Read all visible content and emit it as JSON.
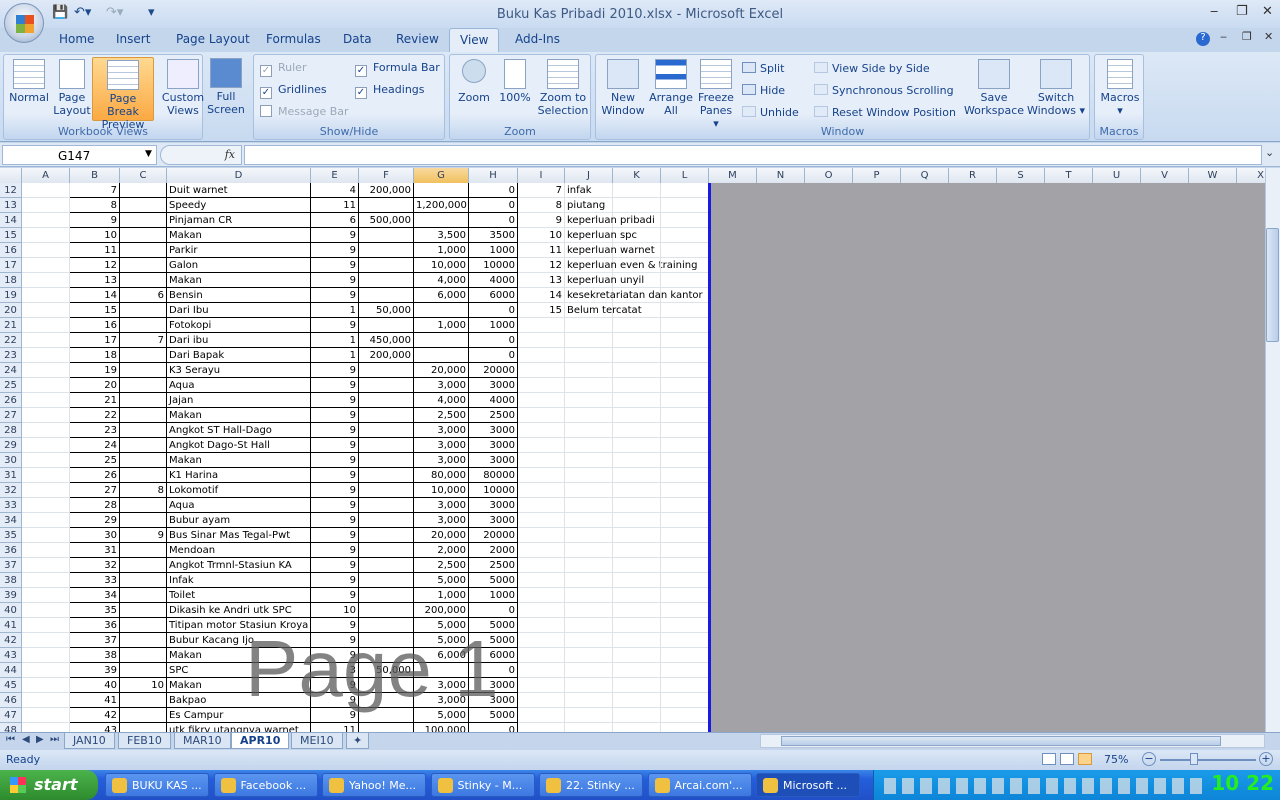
{
  "window": {
    "title": "Buku Kas Pribadi 2010.xlsx - Microsoft Excel",
    "minimize": "‒",
    "restore": "❐",
    "close": "✕"
  },
  "ribbon_tabs": [
    "Home",
    "Insert",
    "Page Layout",
    "Formulas",
    "Data",
    "Review",
    "View",
    "Add-Ins"
  ],
  "active_tab": "View",
  "groups": {
    "workbook_views": {
      "label": "Workbook Views",
      "normal": "Normal",
      "page_layout": [
        "Page",
        "Layout"
      ],
      "page_break": [
        "Page Break",
        "Preview"
      ],
      "custom": [
        "Custom",
        "Views"
      ],
      "full": [
        "Full",
        "Screen"
      ]
    },
    "show_hide": {
      "label": "Show/Hide",
      "ruler": "Ruler",
      "gridlines": "Gridlines",
      "message_bar": "Message Bar",
      "formula_bar": "Formula Bar",
      "headings": "Headings",
      "ruler_checked": true,
      "gridlines_checked": true,
      "message_bar_checked": false,
      "formula_bar_checked": true,
      "headings_checked": true
    },
    "zoom": {
      "label": "Zoom",
      "zoom": "Zoom",
      "hundred": "100%",
      "zoom_sel": [
        "Zoom to",
        "Selection"
      ]
    },
    "window": {
      "label": "Window",
      "new": [
        "New",
        "Window"
      ],
      "arrange": [
        "Arrange",
        "All"
      ],
      "freeze": [
        "Freeze",
        "Panes ▾"
      ],
      "split": "Split",
      "hide": "Hide",
      "unhide": "Unhide",
      "side": "View Side by Side",
      "sync": "Synchronous Scrolling",
      "reset": "Reset Window Position",
      "save": [
        "Save",
        "Workspace"
      ],
      "switch": [
        "Switch",
        "Windows ▾"
      ]
    },
    "macros": {
      "label": "Macros",
      "macros": "Macros"
    }
  },
  "formula_bar": {
    "name_box": "G147",
    "fx": "fx",
    "formula": ""
  },
  "columns": [
    "A",
    "B",
    "C",
    "D",
    "E",
    "F",
    "G",
    "H",
    "I",
    "J",
    "K",
    "L",
    "M",
    "N",
    "O",
    "P",
    "Q",
    "R",
    "S",
    "T",
    "U",
    "V",
    "W",
    "X"
  ],
  "selected_column": "G",
  "rows": [
    [
      "12",
      "7",
      "",
      "Duit warnet",
      "4",
      "200,000",
      "",
      "0",
      "7",
      "infak"
    ],
    [
      "13",
      "8",
      "",
      "Speedy",
      "11",
      "",
      "1,200,000",
      "0",
      "8",
      "piutang"
    ],
    [
      "14",
      "9",
      "",
      "Pinjaman CR",
      "6",
      "500,000",
      "",
      "0",
      "9",
      "keperluan pribadi"
    ],
    [
      "15",
      "10",
      "",
      "Makan",
      "9",
      "",
      "3,500",
      "3500",
      "10",
      "keperluan spc"
    ],
    [
      "16",
      "11",
      "",
      "Parkir",
      "9",
      "",
      "1,000",
      "1000",
      "11",
      "keperluan warnet"
    ],
    [
      "17",
      "12",
      "",
      "Galon",
      "9",
      "",
      "10,000",
      "10000",
      "12",
      "keperluan even & training"
    ],
    [
      "18",
      "13",
      "",
      "Makan",
      "9",
      "",
      "4,000",
      "4000",
      "13",
      "keperluan unyil"
    ],
    [
      "19",
      "14",
      "6",
      "Bensin",
      "9",
      "",
      "6,000",
      "6000",
      "14",
      "kesekretariatan dan kantor"
    ],
    [
      "20",
      "15",
      "",
      "Dari Ibu",
      "1",
      "50,000",
      "",
      "0",
      "15",
      "Belum tercatat"
    ],
    [
      "21",
      "16",
      "",
      "Fotokopi",
      "9",
      "",
      "1,000",
      "1000",
      "",
      ""
    ],
    [
      "22",
      "17",
      "7",
      "Dari ibu",
      "1",
      "450,000",
      "",
      "0",
      "",
      ""
    ],
    [
      "23",
      "18",
      "",
      "Dari Bapak",
      "1",
      "200,000",
      "",
      "0",
      "",
      ""
    ],
    [
      "24",
      "19",
      "",
      "K3 Serayu",
      "9",
      "",
      "20,000",
      "20000",
      "",
      ""
    ],
    [
      "25",
      "20",
      "",
      "Aqua",
      "9",
      "",
      "3,000",
      "3000",
      "",
      ""
    ],
    [
      "26",
      "21",
      "",
      "Jajan",
      "9",
      "",
      "4,000",
      "4000",
      "",
      ""
    ],
    [
      "27",
      "22",
      "",
      "Makan",
      "9",
      "",
      "2,500",
      "2500",
      "",
      ""
    ],
    [
      "28",
      "23",
      "",
      "Angkot ST Hall-Dago",
      "9",
      "",
      "3,000",
      "3000",
      "",
      ""
    ],
    [
      "29",
      "24",
      "",
      "Angkot Dago-St Hall",
      "9",
      "",
      "3,000",
      "3000",
      "",
      ""
    ],
    [
      "30",
      "25",
      "",
      "Makan",
      "9",
      "",
      "3,000",
      "3000",
      "",
      ""
    ],
    [
      "31",
      "26",
      "",
      "K1 Harina",
      "9",
      "",
      "80,000",
      "80000",
      "",
      ""
    ],
    [
      "32",
      "27",
      "8",
      "Lokomotif",
      "9",
      "",
      "10,000",
      "10000",
      "",
      ""
    ],
    [
      "33",
      "28",
      "",
      "Aqua",
      "9",
      "",
      "3,000",
      "3000",
      "",
      ""
    ],
    [
      "34",
      "29",
      "",
      "Bubur ayam",
      "9",
      "",
      "3,000",
      "3000",
      "",
      ""
    ],
    [
      "35",
      "30",
      "9",
      "Bus Sinar Mas Tegal-Pwt",
      "9",
      "",
      "20,000",
      "20000",
      "",
      ""
    ],
    [
      "36",
      "31",
      "",
      "Mendoan",
      "9",
      "",
      "2,000",
      "2000",
      "",
      ""
    ],
    [
      "37",
      "32",
      "",
      "Angkot Trmnl-Stasiun KA",
      "9",
      "",
      "2,500",
      "2500",
      "",
      ""
    ],
    [
      "38",
      "33",
      "",
      "Infak",
      "9",
      "",
      "5,000",
      "5000",
      "",
      ""
    ],
    [
      "39",
      "34",
      "",
      "Toilet",
      "9",
      "",
      "1,000",
      "1000",
      "",
      ""
    ],
    [
      "40",
      "35",
      "",
      "Dikasih ke Andri utk SPC",
      "10",
      "",
      "200,000",
      "0",
      "",
      ""
    ],
    [
      "41",
      "36",
      "",
      "Titipan motor Stasiun Kroya",
      "9",
      "",
      "5,000",
      "5000",
      "",
      ""
    ],
    [
      "42",
      "37",
      "",
      "Bubur Kacang Ijo",
      "9",
      "",
      "5,000",
      "5000",
      "",
      ""
    ],
    [
      "43",
      "38",
      "",
      "Makan",
      "9",
      "",
      "6,000",
      "6000",
      "",
      ""
    ],
    [
      "44",
      "39",
      "",
      "SPC",
      "3",
      "50,000",
      "",
      "0",
      "",
      ""
    ],
    [
      "45",
      "40",
      "10",
      "Makan",
      "9",
      "",
      "3,000",
      "3000",
      "",
      ""
    ],
    [
      "46",
      "41",
      "",
      "Bakpao",
      "9",
      "",
      "3,000",
      "3000",
      "",
      ""
    ],
    [
      "47",
      "42",
      "",
      "Es Campur",
      "9",
      "",
      "5,000",
      "5000",
      "",
      ""
    ],
    [
      "48",
      "43",
      "",
      "utk fikry utangnya warnet",
      "11",
      "",
      "100,000",
      "0",
      "",
      ""
    ]
  ],
  "watermark": "Page 1",
  "sheet_tabs": [
    "JAN10",
    "FEB10",
    "MAR10",
    "APR10",
    "MEI10"
  ],
  "active_sheet": "APR10",
  "status": {
    "ready": "Ready",
    "zoom": "75%"
  },
  "taskbar": {
    "start": "start",
    "items": [
      "BUKU KAS ...",
      "Facebook ...",
      "Yahoo! Me...",
      "Stinky - M...",
      "22. Stinky ...",
      "Arcai.com'...",
      "Microsoft ..."
    ],
    "active_item": 6,
    "clock": "10 22"
  }
}
